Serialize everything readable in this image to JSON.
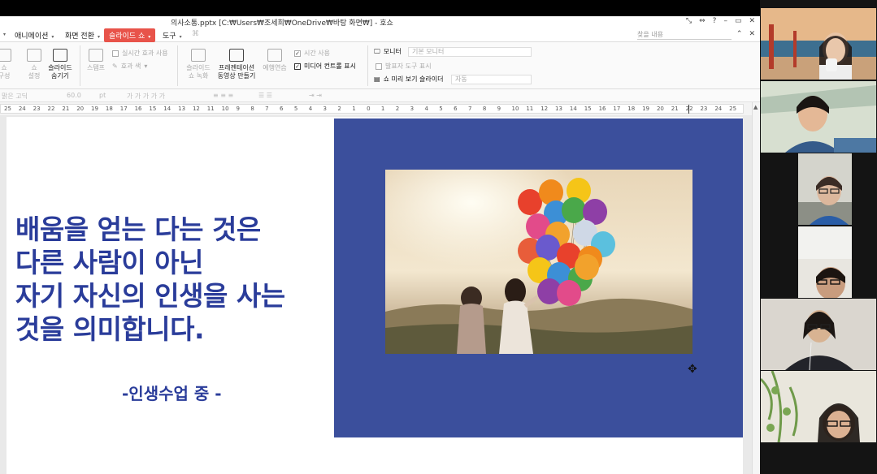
{
  "window": {
    "title": "의사소통.pptx [C:₩Users₩조세희₩OneDrive₩바탕 화면₩] - 호쇼",
    "controls": [
      "⤡",
      "⇔",
      "?",
      "–",
      "▭",
      "✕"
    ]
  },
  "menubar": {
    "items": [
      {
        "label": "애니메이션",
        "active": false
      },
      {
        "label": "화면 전환",
        "active": false
      },
      {
        "label": "슬라이드 쇼",
        "active": true
      },
      {
        "label": "도구",
        "active": false
      }
    ],
    "help_search_placeholder": "찾을 내용",
    "controls": [
      "⌃",
      "✕"
    ]
  },
  "ribbon": {
    "buttons": [
      {
        "label": "쇼\n설정",
        "enabled": false
      },
      {
        "label": "슬라이드\n숨기기",
        "enabled": true
      },
      {
        "label": "스탬프",
        "enabled": false
      },
      {
        "label": "슬라이드\n쇼 녹화",
        "enabled": false
      },
      {
        "label": "프레젠테이션\n동영상 만들기",
        "enabled": true
      },
      {
        "label": "예행연습",
        "enabled": false
      }
    ],
    "left_partial_label": "쇼\n구성",
    "checks": [
      {
        "label": "실시간 효과 사용",
        "checked": false,
        "enabled": false
      },
      {
        "label": "효과 색",
        "checked": false,
        "enabled": false
      },
      {
        "label": "시간 사용",
        "checked": true,
        "enabled": false
      },
      {
        "label": "미디어 컨트롤 표시",
        "checked": true,
        "enabled": true
      },
      {
        "label": "모니터",
        "checked": false,
        "enabled": true
      },
      {
        "label": "발표자 도구 표시",
        "checked": false,
        "enabled": false
      },
      {
        "label": "쇼 미리 보기 슬라이더",
        "checked": false,
        "enabled": true
      }
    ],
    "monitor_value": "기본 모니터",
    "preview_value": "자동"
  },
  "format_bar": {
    "font_name": "맑은 고딕",
    "font_size": "60.0",
    "unit": "pt"
  },
  "ruler": {
    "labels": [
      "25",
      "24",
      "23",
      "22",
      "21",
      "20",
      "19",
      "18",
      "17",
      "16",
      "15",
      "14",
      "13",
      "12",
      "11",
      "10",
      "9",
      "8",
      "7",
      "6",
      "5",
      "4",
      "3",
      "2",
      "1",
      "0",
      "1",
      "2",
      "3",
      "4",
      "5",
      "6",
      "7",
      "8",
      "9",
      "10",
      "11",
      "12",
      "13",
      "14",
      "15",
      "16",
      "17",
      "18",
      "19",
      "20",
      "21",
      "22",
      "23",
      "24",
      "25"
    ]
  },
  "slide": {
    "quote_lines": [
      "배움을 얻는 다는 것은",
      "다른 사람이 아닌",
      "자기 자신의 인생을 사는",
      "것을 의미합니다."
    ],
    "source": "-인생수업 중 -",
    "text_color": "#2a3c9a",
    "panel_color": "#3b4f9c"
  },
  "balloon_colors": [
    "#e8412c",
    "#f08a1c",
    "#f5c518",
    "#3c8fd6",
    "#4aa84a",
    "#8e3fa6",
    "#e24b8a",
    "#f2a22c",
    "#cfd8e6",
    "#5bc0de",
    "#e85d3a",
    "#6a5acd"
  ],
  "gallery": {
    "participant_count": 6
  }
}
